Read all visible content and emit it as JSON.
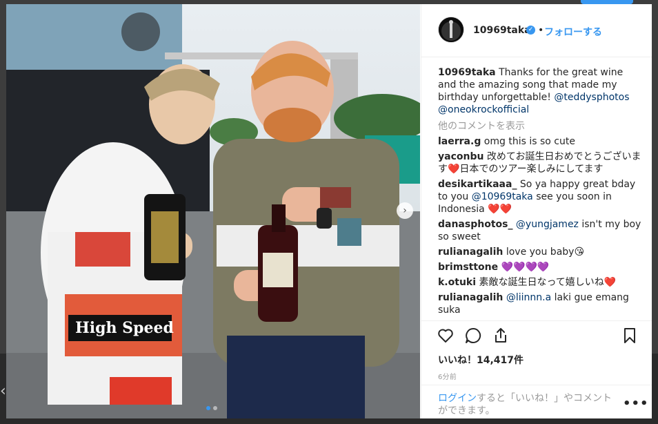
{
  "colors": {
    "accent": "#3897f0",
    "text": "#262626",
    "muted": "#999999",
    "heart": "#ed4956",
    "purple_heart": "#a23cf0"
  },
  "icons": {
    "verified": "verified-badge-icon",
    "like": "heart-outline-icon",
    "comment": "speech-bubble-icon",
    "share": "share-arrow-icon",
    "save": "bookmark-icon",
    "next": "chevron-right-icon",
    "more": "ellipsis-icon"
  },
  "post": {
    "author": "10969taka",
    "follow_label": "フォローする",
    "follow_sep": "•",
    "caption_user": "10969taka",
    "caption_text": "Thanks for the great wine and the amazing song that made my birthday unforgettable!",
    "caption_mention_1": "@teddysphotos",
    "caption_mention_2": "@oneokrockofficial",
    "more_comments": "他のコメントを表示",
    "carousel_index": 1,
    "carousel_total": 2
  },
  "comments": [
    {
      "user": "laerra.g",
      "pre": "omg this is so cute",
      "mention": "",
      "post": ""
    },
    {
      "user": "yaconbu",
      "pre": "改めてお誕生日おめでとうございます❤️日本でのツアー楽しみにしてます",
      "mention": "",
      "post": ""
    },
    {
      "user": "desikartikaaa_",
      "pre": "So ya happy great bday to you",
      "mention": "@10969taka",
      "post": "see you soon in Indonesia ❤️❤️"
    },
    {
      "user": "danasphotos_",
      "pre": "",
      "mention": "@yungjamez",
      "post": "isn't my boy so sweet"
    },
    {
      "user": "rulianagalih",
      "pre": "love you baby😘",
      "mention": "",
      "post": ""
    },
    {
      "user": "brimsttone",
      "pre": "💜💜💜💜",
      "mention": "",
      "post": ""
    },
    {
      "user": "k.otuki",
      "pre": "素敵な誕生日なって嬉しいね❤️",
      "mention": "",
      "post": ""
    },
    {
      "user": "rulianagalih",
      "pre": "",
      "mention": "@liinnn.a",
      "post": "laki gue emang suka"
    }
  ],
  "stats": {
    "likes_label": "いいね！14,417件",
    "time_label": "6分前"
  },
  "login": {
    "link_text": "ログイン",
    "rest_text": "すると「いいね！」やコメントができます。",
    "more": "•••"
  }
}
